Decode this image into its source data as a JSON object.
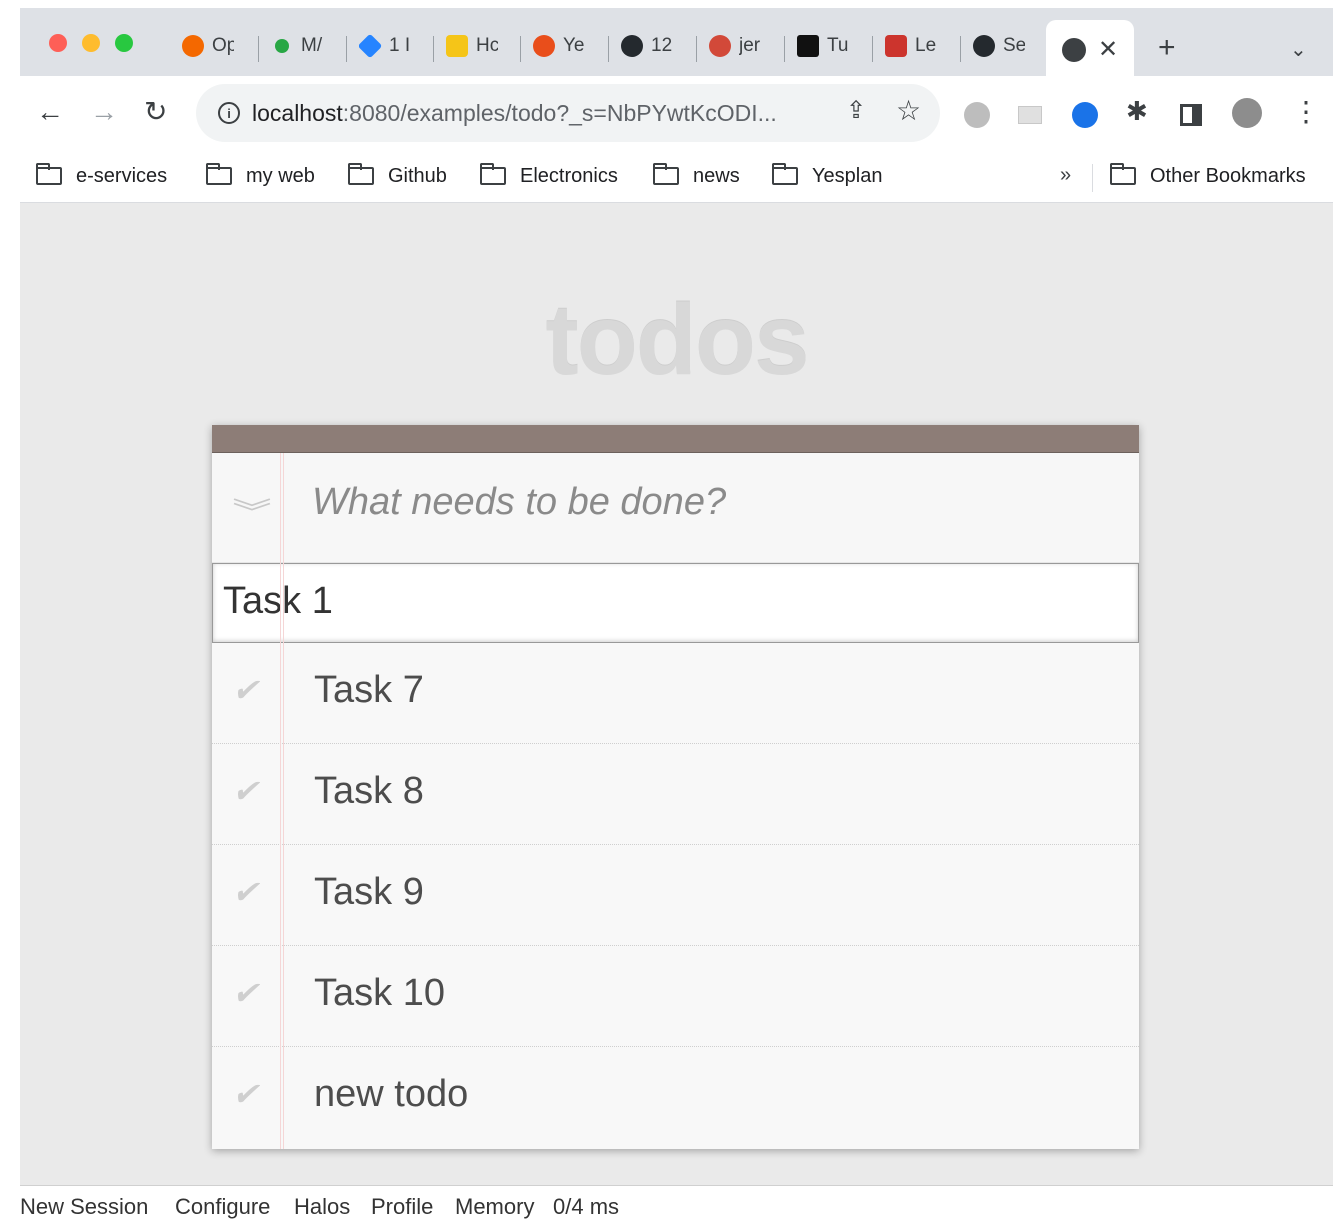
{
  "browser": {
    "tabs": [
      {
        "title": "Op",
        "icon": "grafana-icon",
        "color": "#f46800"
      },
      {
        "title": "M/",
        "icon": "green-dot-icon",
        "color": "#28a745"
      },
      {
        "title": "1 I",
        "icon": "jira-icon",
        "color": "#2684ff"
      },
      {
        "title": "Hc",
        "icon": "yellow-app-icon",
        "color": "#f5c518"
      },
      {
        "title": "Ye",
        "icon": "yesplan-icon",
        "color": "#e94e1b"
      },
      {
        "title": "12",
        "icon": "github-icon",
        "color": "#24292e"
      },
      {
        "title": "jer",
        "icon": "jenkins-icon",
        "color": "#d24939"
      },
      {
        "title": "Tu",
        "icon": "tuta-icon",
        "color": "#111111"
      },
      {
        "title": "Le",
        "icon": "ruby-icon",
        "color": "#cc342d"
      },
      {
        "title": "Se",
        "icon": "github-icon",
        "color": "#24292e"
      }
    ],
    "active_tab": {
      "icon": "globe-icon",
      "close": "✕"
    },
    "new_tab": "+",
    "tab_menu": "⌄",
    "url_host": "localhost",
    "url_rest": ":8080/examples/todo?_s=NbPYwtKcODI...",
    "bookmarks": [
      "e-services",
      "my web",
      "Github",
      "Electronics",
      "news",
      "Yesplan"
    ],
    "bookmarks_more": "»",
    "other_bookmarks": "Other Bookmarks"
  },
  "app": {
    "title": "todos",
    "new_todo_placeholder": "What needs to be done?",
    "toggle_all": "»",
    "editing": "Task 1",
    "todos": [
      {
        "text": "Task 7"
      },
      {
        "text": "Task 8"
      },
      {
        "text": "Task 9"
      },
      {
        "text": "Task 10"
      },
      {
        "text": "new todo"
      }
    ]
  },
  "footer": {
    "items": [
      "New Session",
      "Configure",
      "Halos",
      "Profile",
      "Memory",
      "0/4 ms"
    ]
  }
}
